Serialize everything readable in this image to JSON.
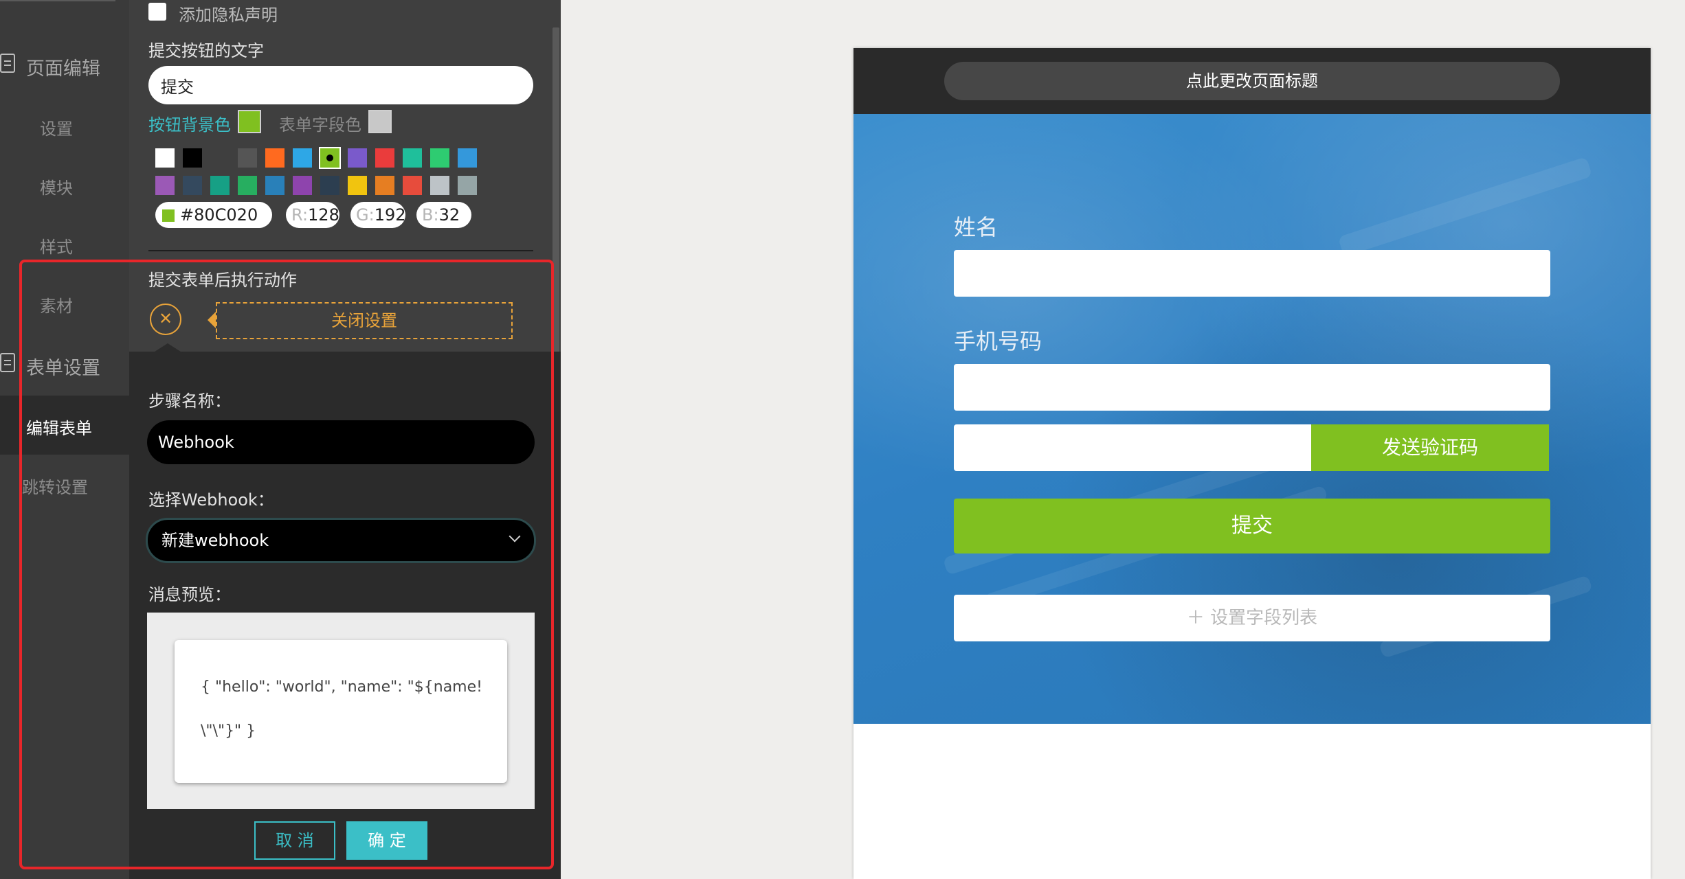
{
  "nav": {
    "page_edit": "页面编辑",
    "settings": "设置",
    "modules": "模块",
    "styles": "样式",
    "materials": "素材",
    "form_settings": "表单设置",
    "edit_form": "编辑表单",
    "redirect_settings": "跳转设置"
  },
  "settings": {
    "privacy_checkbox_label": "添加隐私声明",
    "submit_text_label": "提交按钮的文字",
    "submit_text_value": "提交",
    "button_bg_color_label": "按钮背景色",
    "field_color_label": "表单字段色",
    "color_hex": "#80C020",
    "rgb": {
      "r_label": "R:",
      "r": "128",
      "g_label": "G:",
      "g": "192",
      "b_label": "B:",
      "b": "32"
    },
    "selected_color": "#80C020",
    "field_color": "#c8c8c8",
    "palette_row1": [
      "#ffffff",
      "#000000",
      "#3f3f3f",
      "#555555",
      "#ff6a1f",
      "#2ea7e6",
      "#80c020",
      "#7a5acb",
      "#ea3c3c",
      "#1fbf9b",
      "#2ecc71",
      "#3498db"
    ],
    "palette_row2": [
      "#9b59b6",
      "#34495e",
      "#16a085",
      "#27ae60",
      "#2980b9",
      "#8e44ad",
      "#2c3e50",
      "#f1c40f",
      "#e67e22",
      "#e74c3c",
      "#bdc3c7",
      "#95a5a6"
    ]
  },
  "action": {
    "title": "提交表单后执行动作",
    "close_settings": "关闭设置",
    "step_name_label": "步骤名称：",
    "step_name_value": "Webhook",
    "select_webhook_label": "选择Webhook：",
    "select_webhook_value": "新建webhook",
    "message_preview_label": "消息预览：",
    "message_preview_line1": "{ \"hello\": \"world\", \"name\": \"${name!",
    "message_preview_line2": "\\\"\\\"}\" }",
    "cancel": "取 消",
    "confirm": "确 定"
  },
  "preview": {
    "page_title_button": "点此更改页面标题",
    "field_name_label": "姓名",
    "field_phone_label": "手机号码",
    "send_code_button": "发送验证码",
    "submit_button": "提交",
    "set_fields_button": "＋  设置字段列表"
  },
  "colors": {
    "accent_teal": "#3bbfc7",
    "highlight_red": "#e8262a",
    "orange": "#e8a33a",
    "green": "#80c020",
    "hero_blue": "#2f80c3"
  }
}
